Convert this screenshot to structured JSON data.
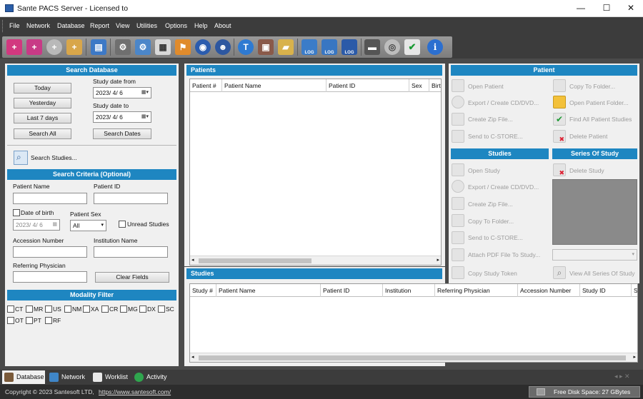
{
  "window": {
    "title": "Sante PACS Server - Licensed to",
    "minimize": "—",
    "maximize": "☐",
    "close": "✕"
  },
  "menu": [
    "File",
    "Network",
    "Database",
    "Report",
    "View",
    "Utilities",
    "Options",
    "Help",
    "About"
  ],
  "search_database": {
    "header": "Search Database",
    "today": "Today",
    "yesterday": "Yesterday",
    "last7": "Last 7 days",
    "search_all": "Search All",
    "date_from_label": "Study date from",
    "date_from": "2023/  4/  6",
    "date_to_label": "Study date to",
    "date_to": "2023/  4/  6",
    "search_dates": "Search Dates",
    "search_studies": "Search Studies..."
  },
  "criteria": {
    "header": "Search Criteria (Optional)",
    "patient_name": "Patient Name",
    "patient_id": "Patient ID",
    "date_of_birth": "Date of birth",
    "dob_value": "2023/  4/  6",
    "patient_sex": "Patient Sex",
    "sex_value": "All",
    "unread": "Unread Studies",
    "accession": "Accession Number",
    "institution": "Institution Name",
    "referring": "Referring Physician",
    "clear": "Clear Fields"
  },
  "modality": {
    "header": "Modality Filter",
    "items": [
      "CT",
      "MR",
      "US",
      "NM",
      "XA",
      "CR",
      "MG",
      "DX",
      "SC",
      "OT",
      "PT",
      "RF"
    ]
  },
  "patients": {
    "header": "Patients",
    "columns": [
      "Patient #",
      "Patient Name",
      "Patient ID",
      "Sex",
      "Birt"
    ]
  },
  "studies": {
    "header": "Studies",
    "columns": [
      "Study #",
      "Patient Name",
      "Patient ID",
      "Institution",
      "Referring Physician",
      "Accession Number",
      "Study ID",
      "S"
    ]
  },
  "patient_actions": {
    "header": "Patient",
    "items": [
      "Open Patient",
      "Copy To Folder...",
      "Export / Create CD/DVD...",
      "Open Patient Folder...",
      "Create Zip File...",
      "Find All Patient Studies",
      "Send to C-STORE...",
      "Delete Patient"
    ]
  },
  "study_actions": {
    "header": "Studies",
    "items": [
      "Open Study",
      "Export / Create CD/DVD...",
      "Create Zip File...",
      "Copy To Folder...",
      "Send to C-STORE...",
      "Attach PDF File To Study...",
      "Copy Study Token"
    ]
  },
  "series": {
    "header": "Series Of Study",
    "delete": "Delete Study",
    "view_all": "View All Series Of Study"
  },
  "tabs": [
    "Database",
    "Network",
    "Worklist",
    "Activity"
  ],
  "status": {
    "copyright": "Copyright © 2023 Santesoft LTD,",
    "url": "https://www.santesoft.com/",
    "disk": "Free Disk Space: 27 GBytes"
  },
  "toolbar_log": "LOG"
}
